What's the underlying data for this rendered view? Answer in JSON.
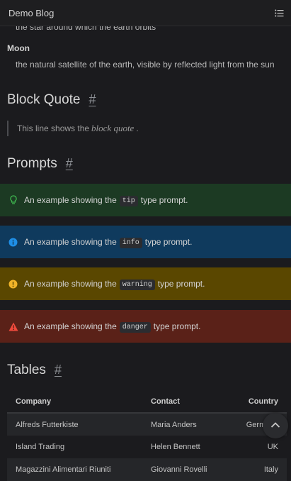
{
  "header": {
    "site_title": "Demo Blog",
    "toc_icon": "list-icon"
  },
  "definitions": {
    "sun_desc": "the star around which the earth orbits",
    "moon_term": "Moon",
    "moon_desc": "the natural satellite of the earth, visible by reflected light from the sun"
  },
  "sections": {
    "block_quote": {
      "title": "Block Quote",
      "anchor": "#"
    },
    "prompts": {
      "title": "Prompts",
      "anchor": "#"
    },
    "tables": {
      "title": "Tables",
      "anchor": "#"
    }
  },
  "blockquote": {
    "before": "This line shows the",
    "emphasis": "block quote",
    "after": "."
  },
  "prompts": [
    {
      "type": "tip",
      "icon": "lightbulb-icon",
      "before": "An example showing the",
      "code": "tip",
      "after": "type prompt.",
      "color": "#1c3a23"
    },
    {
      "type": "info",
      "icon": "info-circle-icon",
      "before": "An example showing the",
      "code": "info",
      "after": "type prompt.",
      "color": "#0f3a5d"
    },
    {
      "type": "warning",
      "icon": "exclamation-circle-icon",
      "before": "An example showing the",
      "code": "warning",
      "after": "type prompt.",
      "color": "#5a4700"
    },
    {
      "type": "danger",
      "icon": "warning-triangle-icon",
      "before": "An example showing the",
      "code": "danger",
      "after": "type prompt.",
      "color": "#5a2118"
    }
  ],
  "table": {
    "headers": [
      "Company",
      "Contact",
      "Country"
    ],
    "rows": [
      [
        "Alfreds Futterkiste",
        "Maria Anders",
        "Germany"
      ],
      [
        "Island Trading",
        "Helen Bennett",
        "UK"
      ],
      [
        "Magazzini Alimentari Riuniti",
        "Giovanni Rovelli",
        "Italy"
      ]
    ]
  },
  "scroll_top": {
    "icon": "chevron-up-icon"
  }
}
